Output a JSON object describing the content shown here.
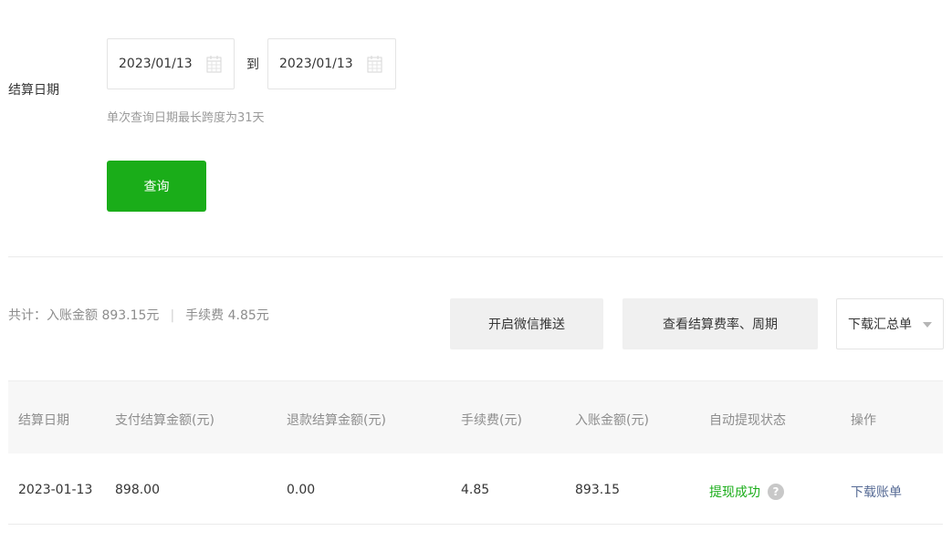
{
  "form": {
    "label": "结算日期",
    "start_date": "2023/01/13",
    "to": "到",
    "end_date": "2023/01/13",
    "hint": "单次查询日期最长跨度为31天",
    "query_button": "查询"
  },
  "summary": {
    "income": "共计：入账金额 893.15元",
    "separator": "|",
    "fee": "手续费 4.85元"
  },
  "actions": {
    "wechat_push": "开启微信推送",
    "view_rate": "查看结算费率、周期",
    "download_summary": "下载汇总单"
  },
  "table": {
    "headers": [
      "结算日期",
      "支付结算金额(元)",
      "退款结算金额(元)",
      "手续费(元)",
      "入账金额(元)",
      "自动提现状态",
      "操作"
    ],
    "rows": [
      {
        "date": "2023-01-13",
        "pay_amount": "898.00",
        "refund_amount": "0.00",
        "fee": "4.85",
        "income": "893.15",
        "status": "提现成功",
        "action": "下载账单"
      }
    ]
  },
  "colors": {
    "primary_green": "#1aad19",
    "link_blue": "#576b95",
    "muted_text": "#8d8d8d"
  }
}
